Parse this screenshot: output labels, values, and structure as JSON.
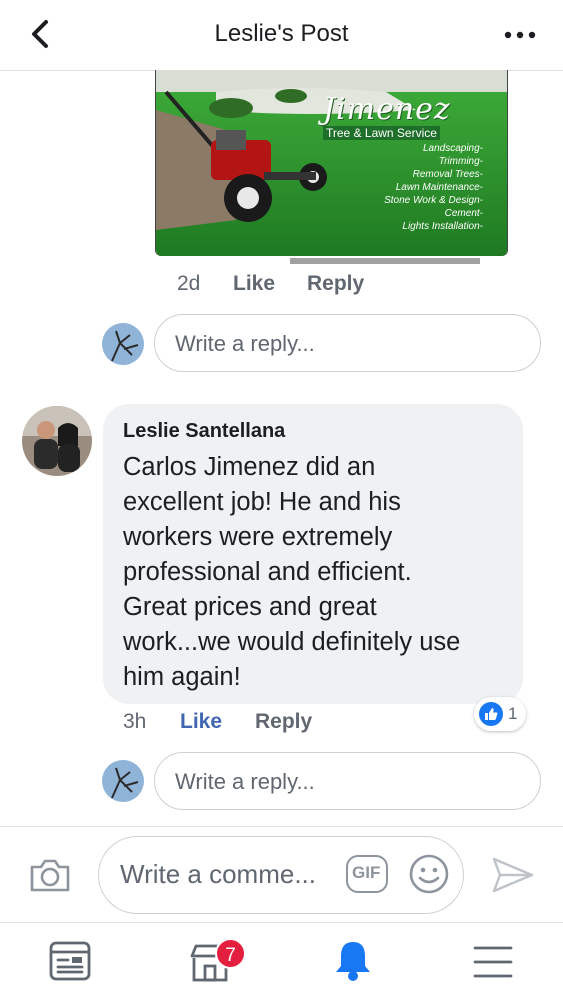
{
  "header": {
    "title": "Leslie's Post"
  },
  "ad": {
    "brand": "Jimenez",
    "brand_sub": "Tree & Lawn Service",
    "services": [
      "Landscaping-",
      "Trimming-",
      "Removal Trees-",
      "Lawn Maintenance-",
      "Stone Work & Design-",
      "Cement-",
      "Lights Installation-"
    ]
  },
  "first_comment_meta": {
    "time": "2d",
    "like_label": "Like",
    "reply_label": "Reply"
  },
  "reply_box_1": {
    "placeholder": "Write a reply..."
  },
  "comment": {
    "author": "Leslie Santellana",
    "lines": [
      "Carlos Jimenez did an",
      "excellent job! He and his",
      "workers were extremely",
      "professional and efficient.",
      "Great prices and great",
      "work...we would definitely use",
      "him again!"
    ],
    "time": "3h",
    "like_label": "Like",
    "reply_label": "Reply",
    "reaction_count": "1"
  },
  "reply_box_2": {
    "placeholder": "Write a reply..."
  },
  "composer": {
    "placeholder": "Write a comme...",
    "gif_label": "GIF"
  },
  "tabbar": {
    "marketplace_badge": "7"
  },
  "colors": {
    "link_blue": "#4267b2",
    "badge_red": "#e41e3f",
    "bell_blue": "#1877f2"
  }
}
